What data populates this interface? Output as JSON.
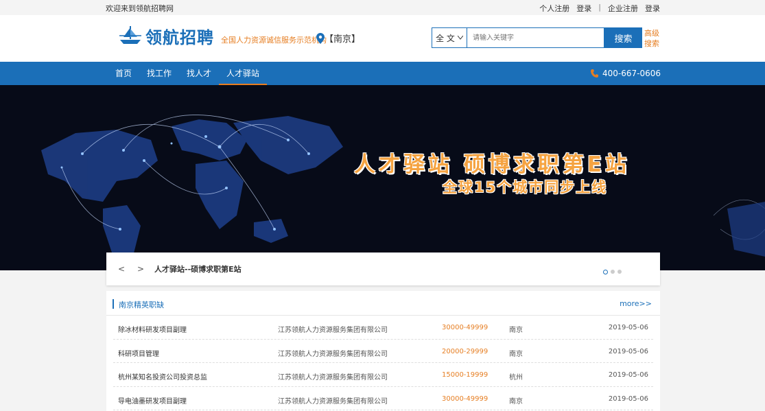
{
  "topbar": {
    "welcome": "欢迎来到领航招聘网",
    "personal_register": "个人注册",
    "personal_login": "登录",
    "separator": "|",
    "company_register": "企业注册",
    "company_login": "登录"
  },
  "header": {
    "logo_text": "领航招聘",
    "slogan": "全国人力资源诚信服务示范机构",
    "city": "【南京】",
    "search_scope": "全 文",
    "search_placeholder": "请输入关键字",
    "search_button": "搜索",
    "advanced_search": "高级搜索"
  },
  "nav": {
    "items": [
      "首页",
      "找工作",
      "找人才",
      "人才驿站"
    ],
    "active_index": 3,
    "phone": "400-667-0606"
  },
  "banner": {
    "title": "人才驿站 硕博求职第E站",
    "subtitle": "全球15个城市同步上线"
  },
  "breadcrumb": {
    "prev": "<",
    "next": ">",
    "text": "人才驿站--硕博求职第E站"
  },
  "jobs_section": {
    "title": "南京精英职缺",
    "more": "more>>",
    "rows": [
      {
        "title": "除冰材料研发项目副理",
        "company": "江苏领航人力资源服务集团有限公司",
        "salary": "30000-49999",
        "city": "南京",
        "date": "2019-05-06"
      },
      {
        "title": "科研项目管理",
        "company": "江苏领航人力资源服务集团有限公司",
        "salary": "20000-29999",
        "city": "南京",
        "date": "2019-05-06"
      },
      {
        "title": "杭州某知名投资公司投资总监",
        "company": "江苏领航人力资源服务集团有限公司",
        "salary": "15000-19999",
        "city": "杭州",
        "date": "2019-05-06"
      },
      {
        "title": "导电油墨研发项目副理",
        "company": "江苏领航人力资源服务集团有限公司",
        "salary": "30000-49999",
        "city": "南京",
        "date": "2019-05-06"
      }
    ]
  },
  "colors": {
    "brand_blue": "#1b6fb8",
    "accent_orange": "#e67e22"
  }
}
